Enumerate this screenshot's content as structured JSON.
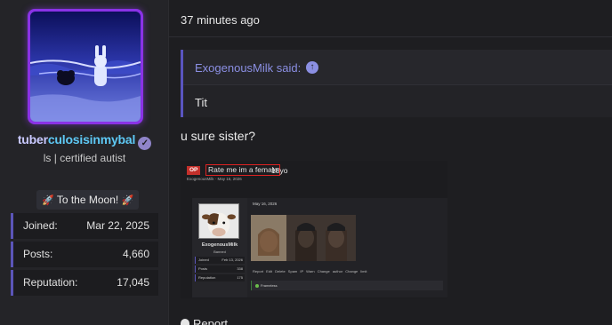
{
  "user": {
    "name_part1": "tuber",
    "name_part2": "culosisinmybal",
    "title": "ls | certified autist",
    "badge_icon": "rocket-icon",
    "badge_text": "To the Moon!",
    "stats": [
      {
        "label": "Joined:",
        "value": "Mar 22, 2025"
      },
      {
        "label": "Posts:",
        "value": "4,660"
      },
      {
        "label": "Reputation:",
        "value": "17,045"
      }
    ]
  },
  "post": {
    "timestamp": "37 minutes ago",
    "quote": {
      "author": "ExogenousMilk said:",
      "text": "Tit"
    },
    "reply_text": "u sure sister?",
    "embed": {
      "op_tag": "OP",
      "thread_title": "Rate me im a female",
      "age_tag": "18yo",
      "meta": "ExogenousMilk · May 16, 2026",
      "post_user": "ExogenousMilk",
      "post_user_role": "Banned",
      "post_date": "May 16, 2026",
      "stats": [
        {
          "label": "Joined",
          "value": "Feb 13, 2026"
        },
        {
          "label": "Posts",
          "value": "338"
        },
        {
          "label": "Reputation",
          "value": "175"
        }
      ],
      "actions": "Report  Edit  Delete  Spam  IP  Warn  Change author  Change limit",
      "reaction_user": "Frameless"
    },
    "report_label": "Report"
  },
  "colors": {
    "accent": "#5b55b8",
    "link": "#8b8fe3",
    "username_primary": "#c9c9ff",
    "username_secondary": "#5ec9f5"
  }
}
